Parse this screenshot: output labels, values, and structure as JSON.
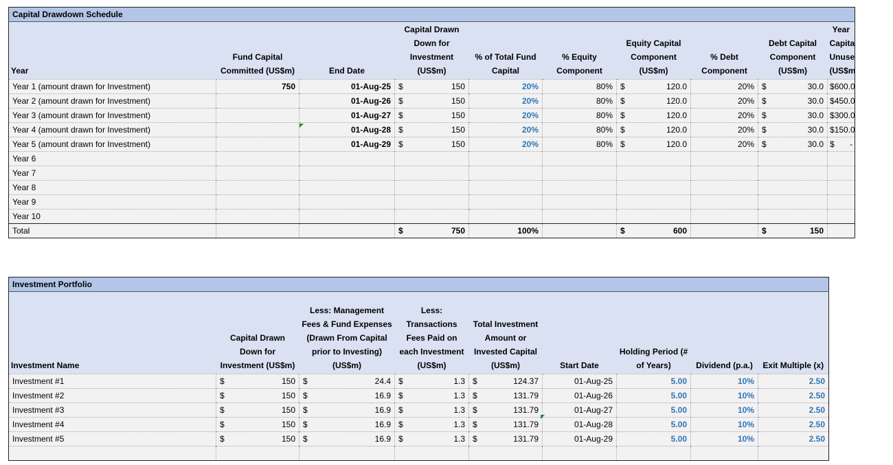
{
  "drawdown": {
    "title": "Capital Drawdown Schedule",
    "headers": {
      "year": "Year",
      "committed": "Fund Capital Committed (US$m)",
      "end_date": "End Date",
      "drawn": "Capital Drawn Down for Investment (US$m)",
      "pct_total": "% of Total Fund Capital",
      "pct_equity": "% Equity Component",
      "equity_comp": "Equity Capital Component (US$m)",
      "pct_debt": "% Debt Component",
      "debt_comp": "Debt Capital Component (US$m)",
      "unused": "Year Capital Unused (US$m)"
    },
    "rows": [
      {
        "year": "Year 1 (amount drawn for Investment)",
        "committed": "750",
        "end_date": "01-Aug-25",
        "drawn": "150",
        "pct_total": "20%",
        "pct_equity": "80%",
        "equity": "120.0",
        "pct_debt": "20%",
        "debt": "30.0",
        "unused": "600.0"
      },
      {
        "year": "Year 2 (amount drawn for Investment)",
        "committed": "",
        "end_date": "01-Aug-26",
        "drawn": "150",
        "pct_total": "20%",
        "pct_equity": "80%",
        "equity": "120.0",
        "pct_debt": "20%",
        "debt": "30.0",
        "unused": "450.0"
      },
      {
        "year": "Year 3 (amount drawn for Investment)",
        "committed": "",
        "end_date": "01-Aug-27",
        "drawn": "150",
        "pct_total": "20%",
        "pct_equity": "80%",
        "equity": "120.0",
        "pct_debt": "20%",
        "debt": "30.0",
        "unused": "300.0"
      },
      {
        "year": "Year 4 (amount drawn for Investment)",
        "committed": "",
        "end_date": "01-Aug-28",
        "drawn": "150",
        "pct_total": "20%",
        "pct_equity": "80%",
        "equity": "120.0",
        "pct_debt": "20%",
        "debt": "30.0",
        "unused": "150.0"
      },
      {
        "year": "Year 5 (amount drawn for Investment)",
        "committed": "",
        "end_date": "01-Aug-29",
        "drawn": "150",
        "pct_total": "20%",
        "pct_equity": "80%",
        "equity": "120.0",
        "pct_debt": "20%",
        "debt": "30.0",
        "unused": "-"
      }
    ],
    "empty_years": [
      "Year 6",
      "Year 7",
      "Year 8",
      "Year 9",
      "Year 10"
    ],
    "total": {
      "label": "Total",
      "drawn": "750",
      "pct_total": "100%",
      "equity": "600",
      "debt": "150"
    },
    "currency_symbol": "$"
  },
  "portfolio": {
    "title": "Investment Portfolio",
    "headers": {
      "name": "Investment Name",
      "drawn": "Capital Drawn Down for Investment (US$m)",
      "fees": "Less: Management Fees & Fund Expenses (Drawn From Capital prior to Investing) (US$m)",
      "txn": "Less: Transactions Fees Paid on each Investment (US$m)",
      "total": "Total Investment Amount or Invested Capital (US$m)",
      "start": "Start Date",
      "holding": "Holding Period (# of Years)",
      "dividend": "Dividend (p.a.)",
      "exit": "Exit Multiple (x)"
    },
    "rows": [
      {
        "name": "Investment #1",
        "drawn": "150",
        "fees": "24.4",
        "txn": "1.3",
        "total": "124.37",
        "start": "01-Aug-25",
        "holding": "5.00",
        "dividend": "10%",
        "exit": "2.50"
      },
      {
        "name": "Investment #2",
        "drawn": "150",
        "fees": "16.9",
        "txn": "1.3",
        "total": "131.79",
        "start": "01-Aug-26",
        "holding": "5.00",
        "dividend": "10%",
        "exit": "2.50"
      },
      {
        "name": "Investment #3",
        "drawn": "150",
        "fees": "16.9",
        "txn": "1.3",
        "total": "131.79",
        "start": "01-Aug-27",
        "holding": "5.00",
        "dividend": "10%",
        "exit": "2.50"
      },
      {
        "name": "Investment #4",
        "drawn": "150",
        "fees": "16.9",
        "txn": "1.3",
        "total": "131.79",
        "start": "01-Aug-28",
        "holding": "5.00",
        "dividend": "10%",
        "exit": "2.50"
      },
      {
        "name": "Investment #5",
        "drawn": "150",
        "fees": "16.9",
        "txn": "1.3",
        "total": "131.79",
        "start": "01-Aug-29",
        "holding": "5.00",
        "dividend": "10%",
        "exit": "2.50"
      }
    ],
    "currency_symbol": "$"
  },
  "colors": {
    "header_title": "#b4c6e7",
    "header_bg": "#d9e1f2",
    "input_blue": "#2e75b6",
    "comment_marker": "#1e8c2e"
  }
}
